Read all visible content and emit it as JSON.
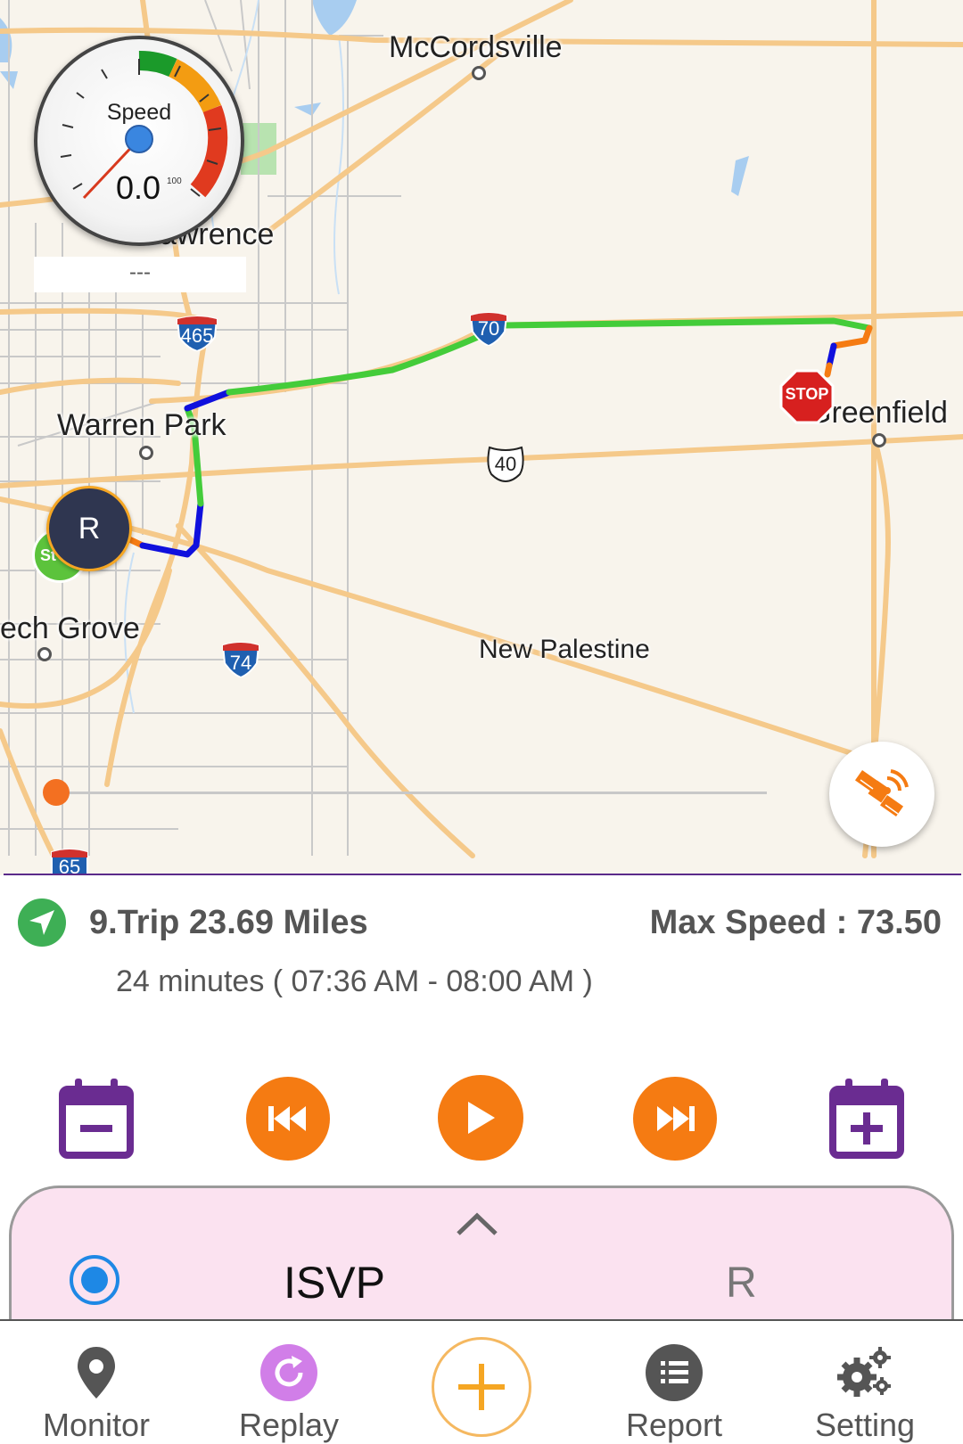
{
  "map": {
    "places": {
      "mccordsville": "McCordsville",
      "lawrence": "Lawrence",
      "warren_park": "Warren Park",
      "greenfield": "Greenfield",
      "beech_grove": "ech Grove",
      "new_palestine": "New Palestine"
    },
    "shields": {
      "i465": "465",
      "i70": "70",
      "us40": "40",
      "i74": "74",
      "i65": "65"
    },
    "route_colors": {
      "fast": "#44cc3a",
      "medium": "#f57b12",
      "slow": "#1010dd"
    }
  },
  "speedometer": {
    "label": "Speed",
    "value": "0.0",
    "max": "100",
    "sub": "---"
  },
  "markers": {
    "stop": "STOP",
    "start": "St",
    "current": "R"
  },
  "timeline": {
    "progress": 0.0
  },
  "trip": {
    "title": "9.Trip 23.69 Miles",
    "max_speed": "Max Speed : 73.50",
    "duration": "24 minutes ( 07:36 AM - 08:00 AM )"
  },
  "device": {
    "name": "ISVP",
    "code": "R"
  },
  "nav": {
    "monitor": "Monitor",
    "replay": "Replay",
    "report": "Report",
    "setting": "Setting"
  },
  "icons": {
    "calendar_minus": "calendar-minus-icon",
    "previous": "skip-previous-icon",
    "play": "play-icon",
    "next": "skip-next-icon",
    "calendar_plus": "calendar-plus-icon",
    "satellite": "satellite-icon"
  },
  "colors": {
    "accent_orange": "#f57b12",
    "calendar_purple": "#6a2c91",
    "panel_pink": "#fbe2f0",
    "radio_blue": "#1e88e5",
    "replay_purple": "#d17ee8"
  }
}
